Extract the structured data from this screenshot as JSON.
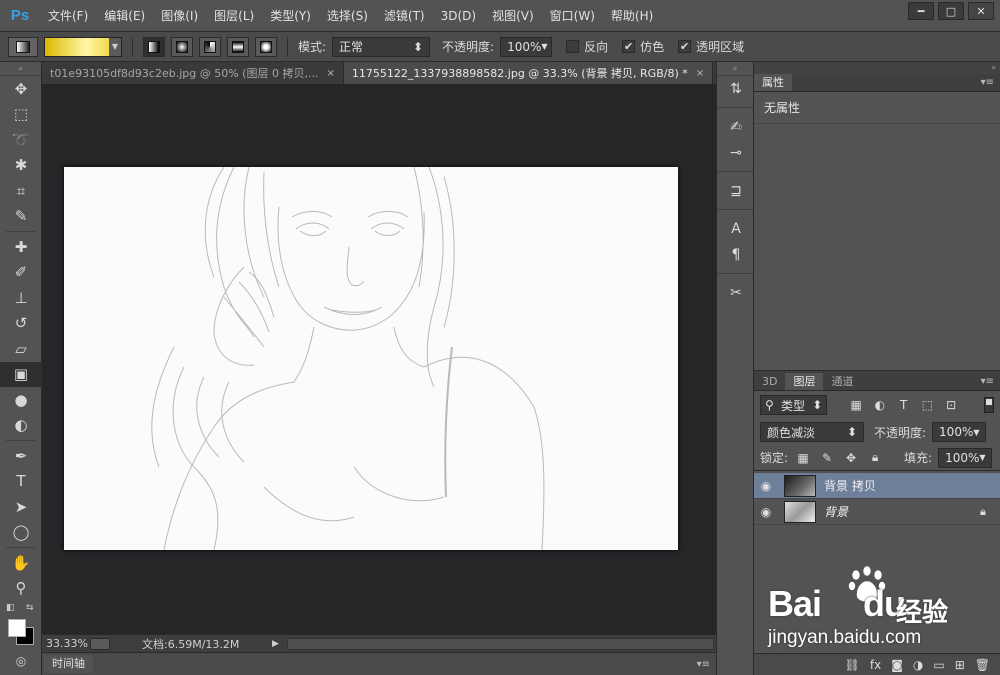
{
  "app": {
    "logo": "Ps"
  },
  "menu": [
    "文件(F)",
    "编辑(E)",
    "图像(I)",
    "图层(L)",
    "类型(Y)",
    "选择(S)",
    "滤镜(T)",
    "3D(D)",
    "视图(V)",
    "窗口(W)",
    "帮助(H)"
  ],
  "window_controls": {
    "minimize": "━",
    "maximize": "□",
    "close": "✕"
  },
  "options": {
    "mode_label": "模式:",
    "mode_value": "正常",
    "opacity_label": "不透明度:",
    "opacity_value": "100%",
    "reverse_label": "反向",
    "dither_label": "仿色",
    "transparency_label": "透明区域",
    "reverse_checked": false,
    "dither_checked": true,
    "transparency_checked": true,
    "check_mark": "✔"
  },
  "tabs": [
    {
      "label": "t01e93105df8d93c2eb.jpg @ 50% (图层 0 拷贝,...",
      "close": "×"
    },
    {
      "label": "11755122_1337938898582.jpg @ 33.3% (背景 拷贝, RGB/8) *",
      "close": "×"
    }
  ],
  "status": {
    "zoom": "33.33%",
    "doc": "文档:6.59M/13.2M",
    "arrow": "▶"
  },
  "timeline": {
    "label": "时间轴"
  },
  "properties": {
    "tab": "属性",
    "message": "无属性"
  },
  "layers_panel": {
    "tabs": [
      "3D",
      "图层",
      "通道"
    ],
    "filter_label": "类型",
    "blend_mode": "颜色减淡",
    "opacity_label": "不透明度:",
    "opacity_value": "100%",
    "lock_label": "锁定:",
    "fill_label": "填充:",
    "fill_value": "100%",
    "layers": [
      {
        "name": "背景 拷贝",
        "selected": true,
        "locked": false
      },
      {
        "name": "背景",
        "selected": false,
        "locked": true
      }
    ],
    "bottom_icons": [
      "link-icon",
      "fx-icon",
      "mask-icon",
      "adjustment-icon",
      "group-icon",
      "new-layer-icon",
      "trash-icon"
    ]
  },
  "watermark": {
    "brand": "Bai",
    "brand2": "du",
    "cn": "经验",
    "url": "jingyan.baidu.com"
  },
  "colors": {
    "menubar": "#535353",
    "panel": "#535353",
    "canvas_bg": "#262528",
    "selected_layer": "#6e7f99",
    "ps_blue": "#3aa0e6"
  }
}
